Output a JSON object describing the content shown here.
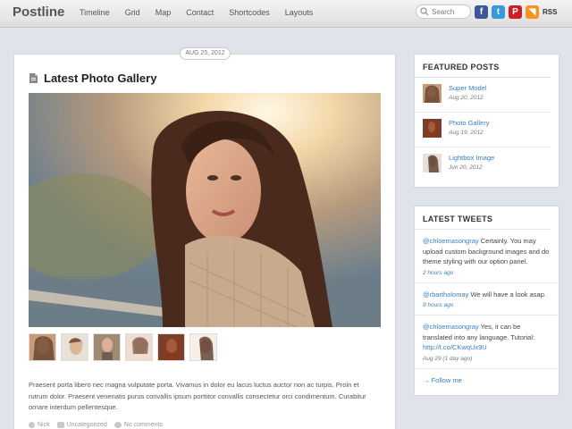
{
  "site": {
    "logo": "Postline"
  },
  "nav": [
    {
      "label": "Timeline"
    },
    {
      "label": "Grid"
    },
    {
      "label": "Map"
    },
    {
      "label": "Contact"
    },
    {
      "label": "Shortcodes"
    },
    {
      "label": "Layouts"
    }
  ],
  "search": {
    "placeholder": "Search"
  },
  "social": {
    "facebook": {
      "glyph": "f",
      "color": "#3b5998"
    },
    "twitter": {
      "glyph": "t",
      "color": "#3a9ad9"
    },
    "pinterest": {
      "glyph": "P",
      "color": "#cb2027"
    },
    "rss": {
      "glyph": "◥",
      "color": "#f7931e",
      "label": "RSS"
    }
  },
  "post": {
    "date": "AUG 25, 2012",
    "title": "Latest Photo Gallery",
    "excerpt": "Praesent porta libero nec magna vulputate porta. Vivamus in dolor eu lacus luctus auctor non ac turpis. Proin et rutrum dolor. Praesent venenatis purus convallis ipsum porttitor convallis consectetur orci condimentum. Curabitur ornare interdum pellentesque.",
    "meta": {
      "author": "Nick",
      "category": "Uncategorized",
      "comments": "No comments"
    }
  },
  "featured": {
    "title": "FEATURED POSTS",
    "items": [
      {
        "label": "Super Model",
        "date": "Aug 20, 2012"
      },
      {
        "label": "Photo Gallery",
        "date": "Aug 19, 2012"
      },
      {
        "label": "Lightbox Image",
        "date": "Jun 20, 2012"
      }
    ]
  },
  "tweets": {
    "title": "LATEST TWEETS",
    "items": [
      {
        "user": "@chloemasongray",
        "text": " Certainly. You may upload custom background images and do theme styling with our option panel.",
        "link": "",
        "time": "2 hours ago"
      },
      {
        "user": "@rbartholomay",
        "text": " We will have a look asap.",
        "link": "",
        "time": "9 hours ago"
      },
      {
        "user": "@chloemasongray",
        "text": " Yes, it can be translated into any language. Tutorial: ",
        "link": "http://t.co/CKwqUx9U",
        "time": "Aug 29 (1 day ago)"
      }
    ],
    "follow": "→ Follow me"
  }
}
